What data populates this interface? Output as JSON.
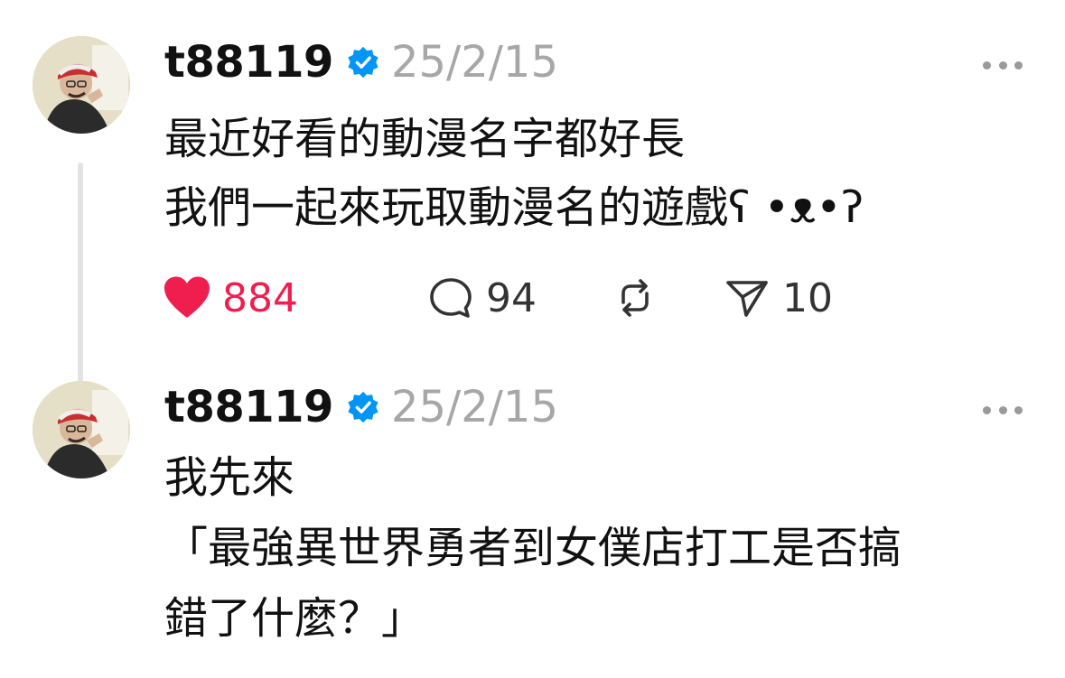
{
  "posts": [
    {
      "username": "t88119",
      "date": "25/2/15",
      "lines": [
        "最近好看的動漫名字都好長",
        "我們一起來玩取動漫名的遊戲ʕ •ᴥ•ʔ"
      ],
      "actions": {
        "likes": "884",
        "comments": "94",
        "shares": "10"
      }
    },
    {
      "username": "t88119",
      "date": "25/2/15",
      "lines": [
        "我先來",
        "「最強異世界勇者到女僕店打工是否搞",
        "錯了什麼？」"
      ]
    }
  ],
  "colors": {
    "like_red": "#ef1e4f",
    "verified_blue": "#0095f6",
    "meta_gray": "#a7a7a7"
  },
  "icons": [
    "heart-icon",
    "comment-icon",
    "repost-icon",
    "share-icon",
    "verified-badge-icon",
    "more-icon"
  ]
}
